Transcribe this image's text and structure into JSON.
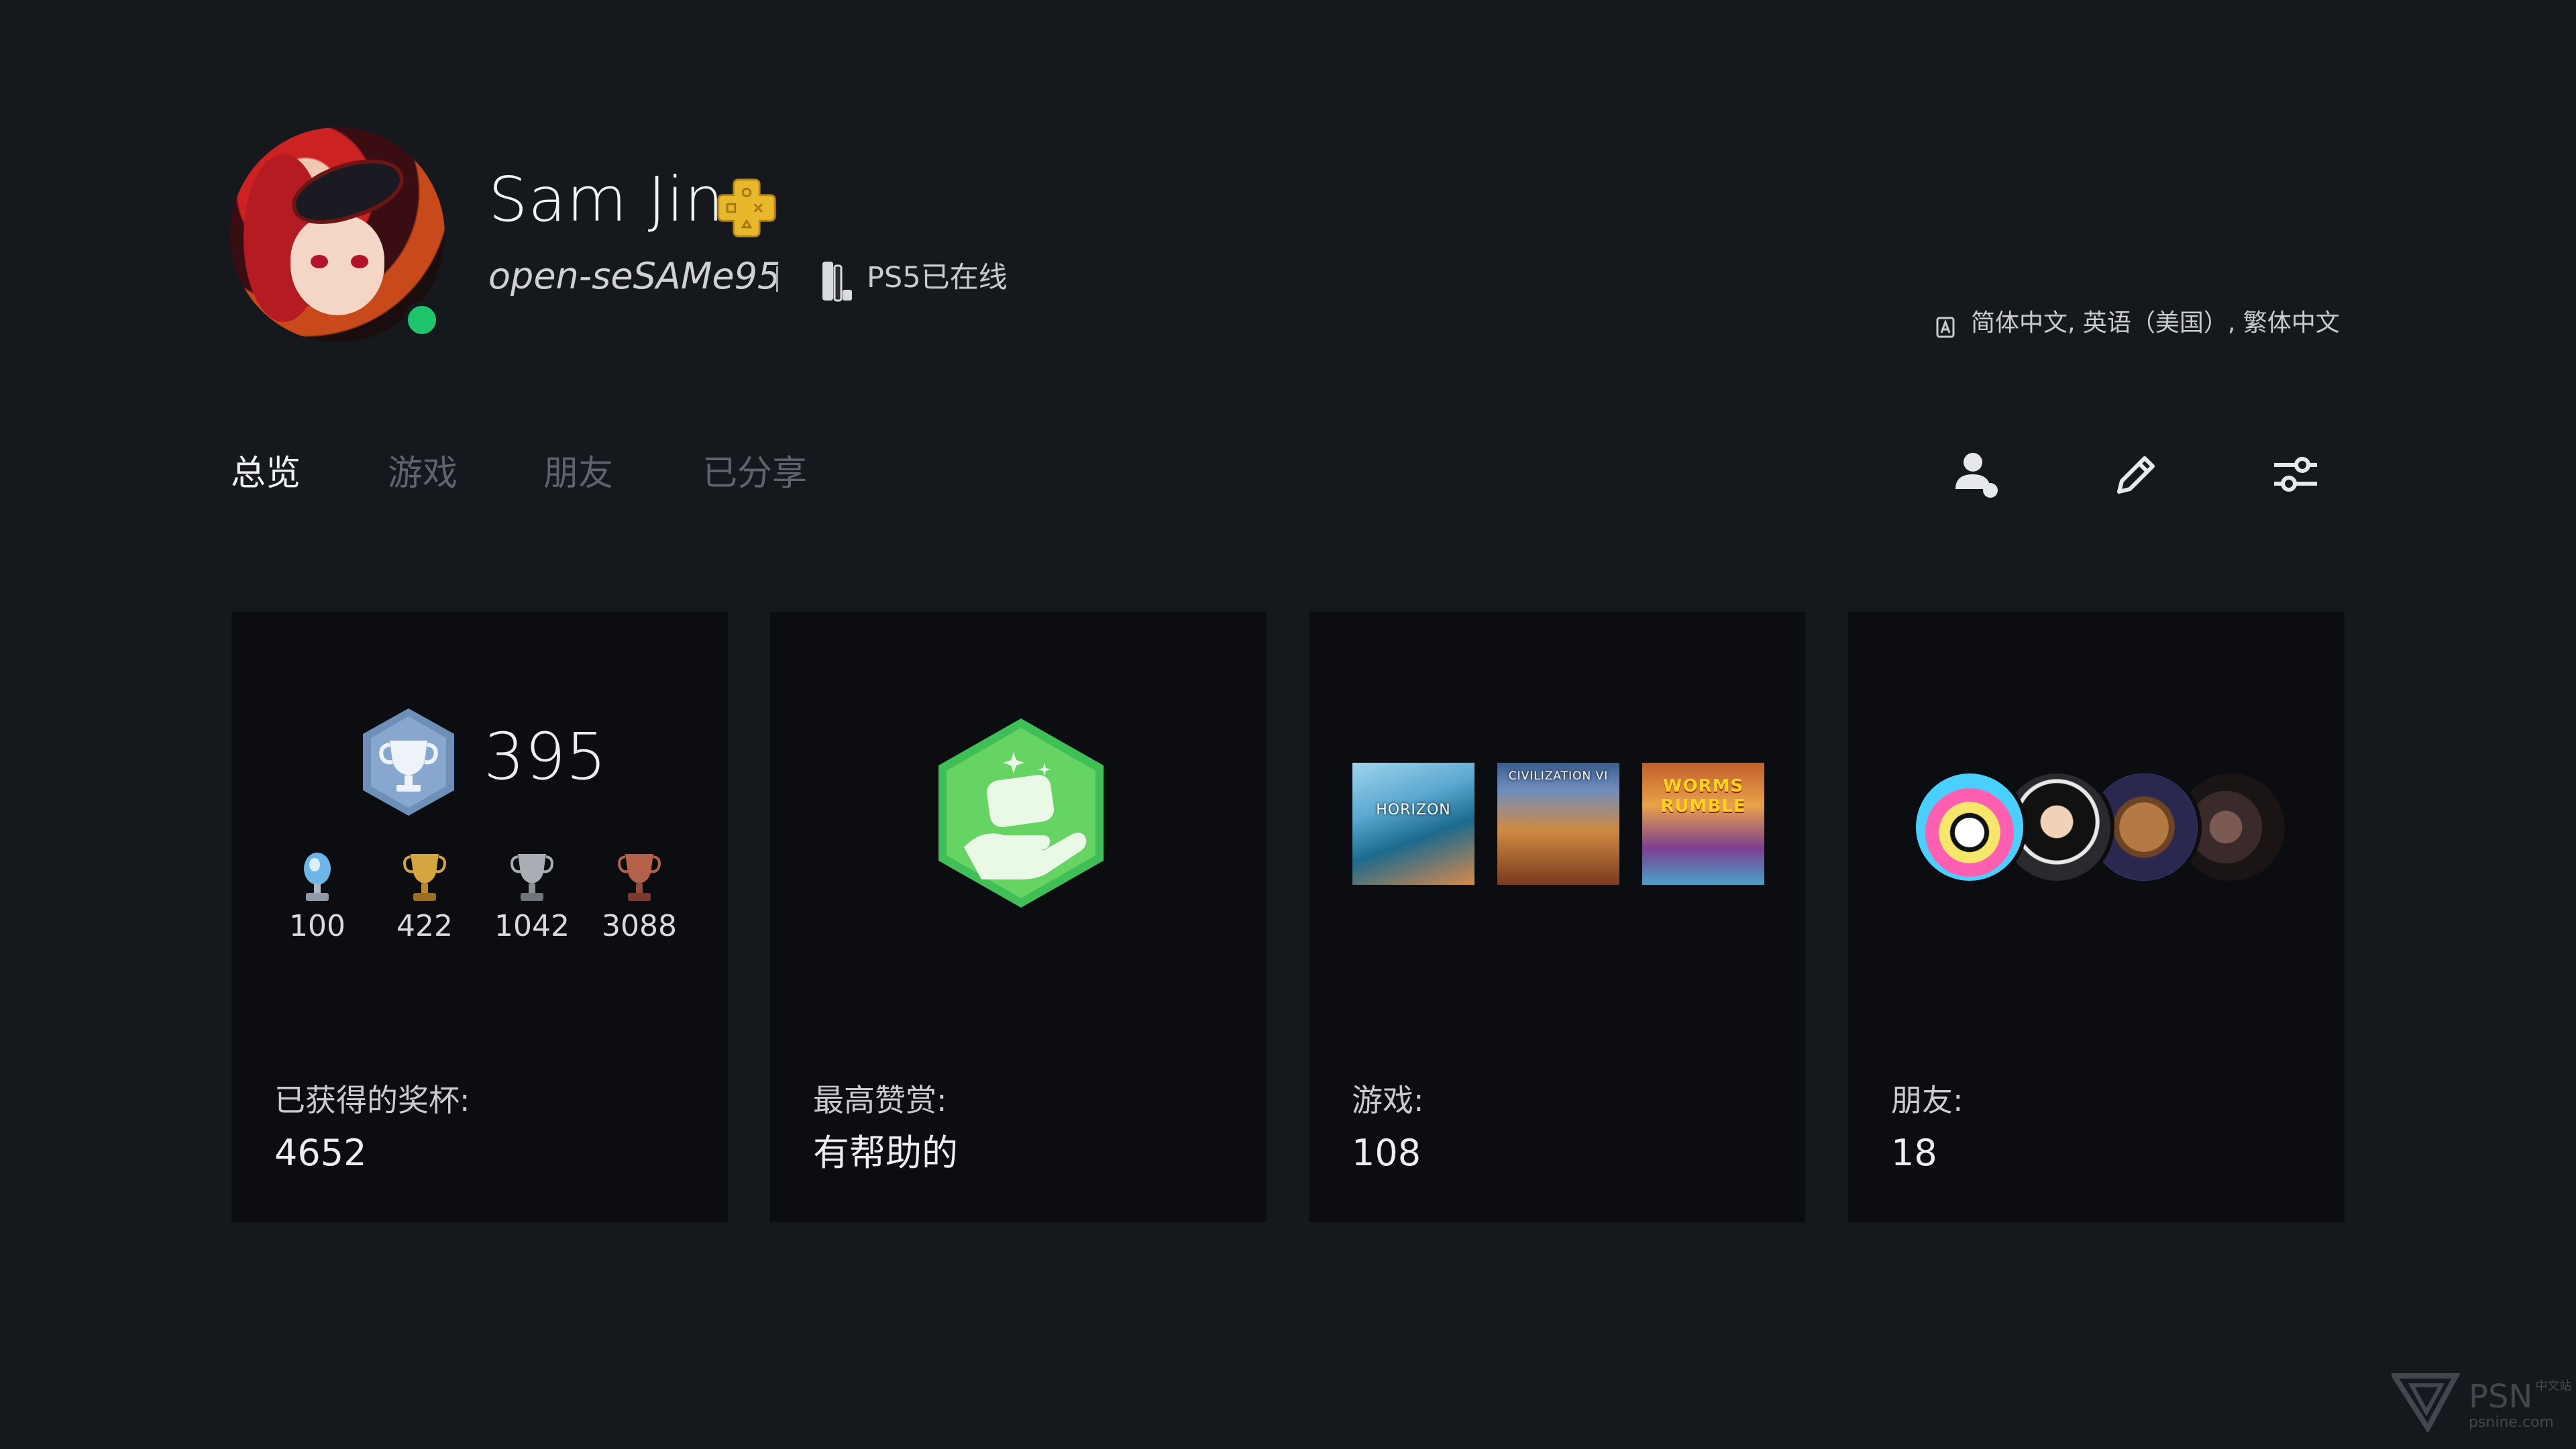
{
  "profile": {
    "name": "Sam Jin",
    "online_id": "open-seSAMe95",
    "status": "PS5已在线",
    "languages": "简体中文, 英语（美国）, 繁体中文",
    "online_color": "#1ec46a"
  },
  "tabs": [
    {
      "label": "总览",
      "active": true
    },
    {
      "label": "游戏",
      "active": false
    },
    {
      "label": "朋友",
      "active": false
    },
    {
      "label": "已分享",
      "active": false
    }
  ],
  "actions": [
    "add-friend-icon",
    "edit-pencil-icon",
    "settings-sliders-icon"
  ],
  "trophies": {
    "level": "395",
    "platinum": "100",
    "gold": "422",
    "silver": "1042",
    "bronze": "3088",
    "label": "已获得的奖杯:",
    "total": "4652"
  },
  "top_prop": {
    "label": "最高赞赏:",
    "value": "有帮助的"
  },
  "games": {
    "label": "游戏:",
    "count": "108",
    "tiles": [
      "HORIZON",
      "CIVILIZATION VI",
      "WORMS RUMBLE"
    ]
  },
  "friends": {
    "label": "朋友:",
    "count": "18"
  },
  "watermark": {
    "brand": "PSN",
    "tag": "中文站",
    "site": "psnine.com"
  }
}
